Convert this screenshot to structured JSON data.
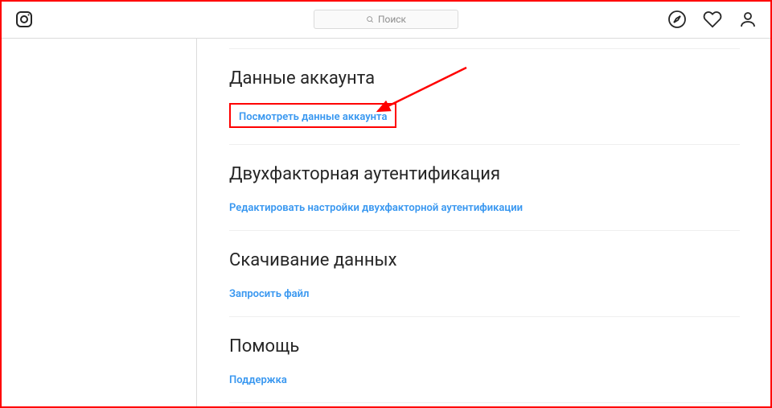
{
  "search": {
    "placeholder": "Поиск"
  },
  "sections": [
    {
      "title": "Данные аккаунта",
      "link": "Посмотреть данные аккаунта"
    },
    {
      "title": "Двухфакторная аутентификация",
      "link": "Редактировать настройки двухфакторной аутентификации"
    },
    {
      "title": "Скачивание данных",
      "link": "Запросить файл"
    },
    {
      "title": "Помощь",
      "link": "Поддержка"
    }
  ]
}
